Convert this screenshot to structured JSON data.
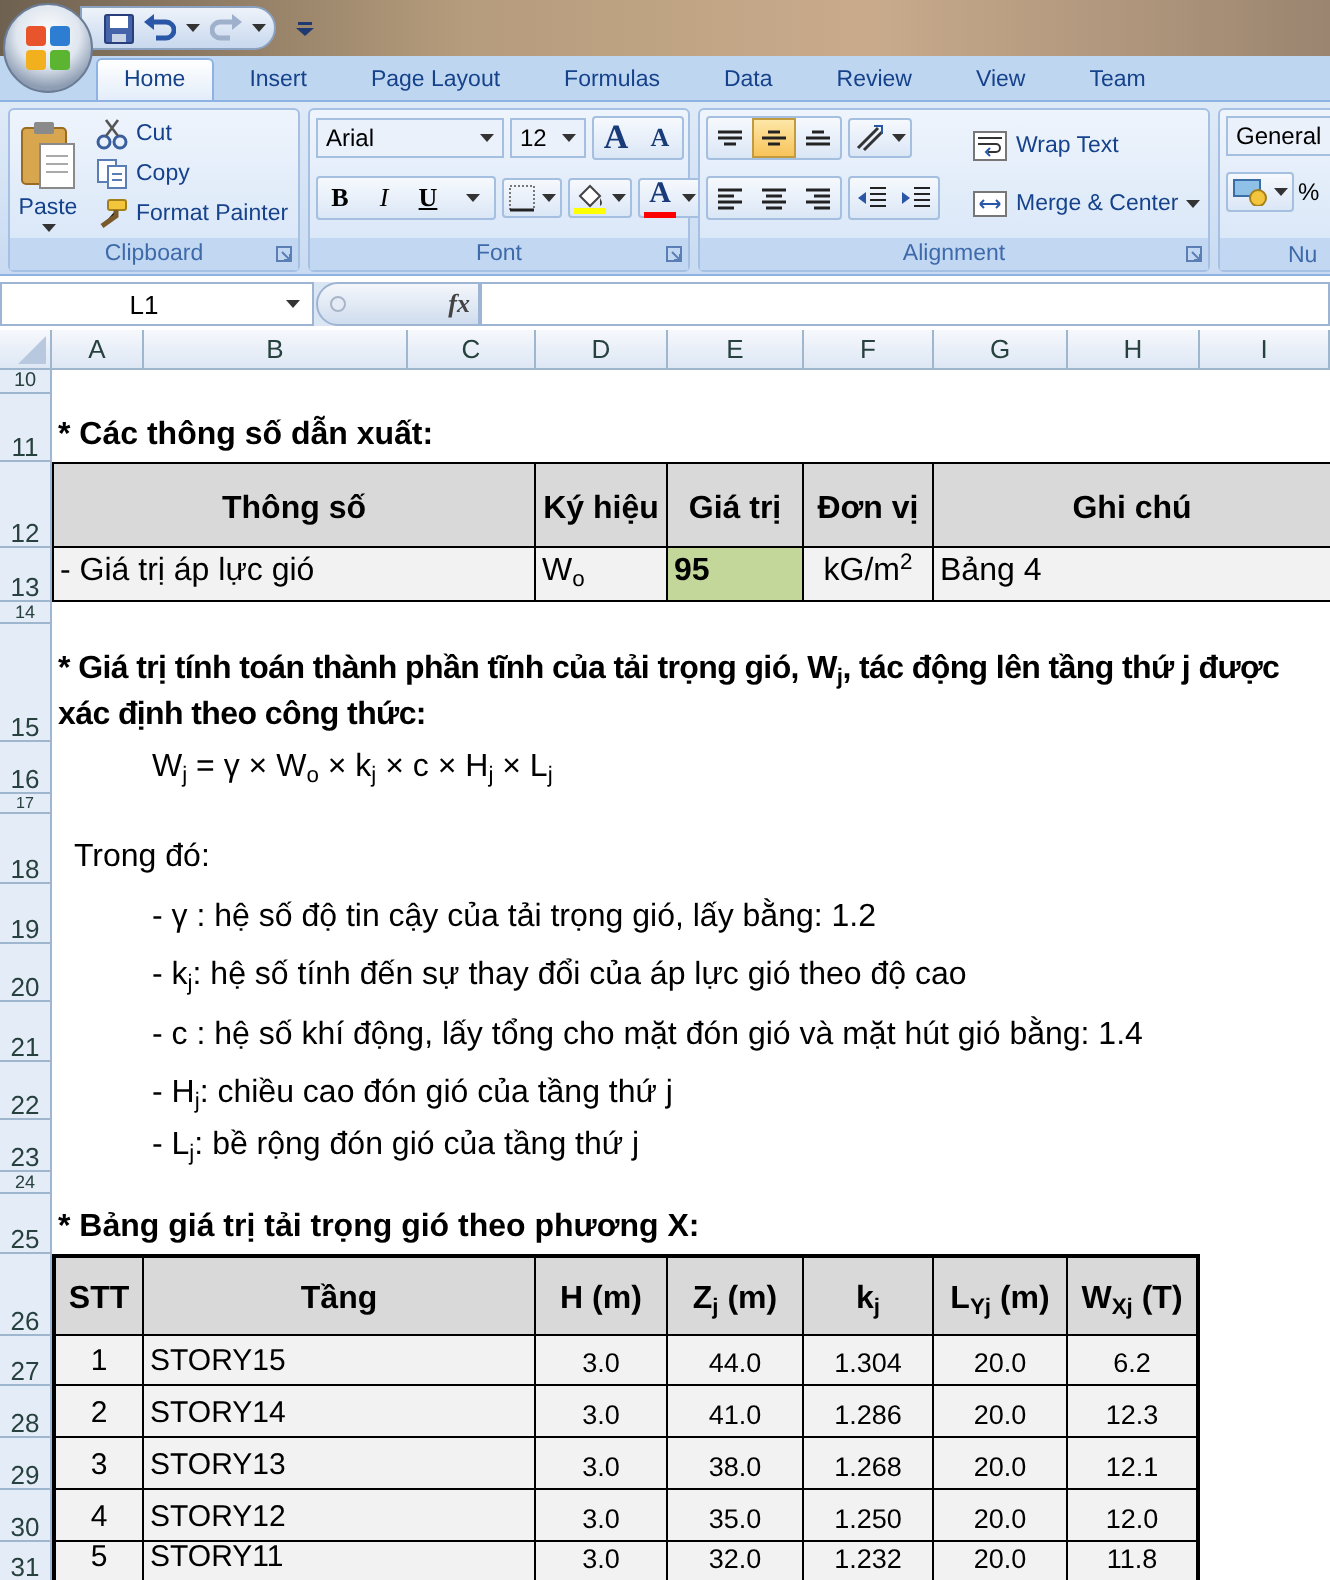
{
  "ribbon": {
    "tabs": [
      {
        "label": "Home",
        "selected": true
      },
      {
        "label": "Insert",
        "selected": false
      },
      {
        "label": "Page Layout",
        "selected": false
      },
      {
        "label": "Formulas",
        "selected": false
      },
      {
        "label": "Data",
        "selected": false
      },
      {
        "label": "Review",
        "selected": false
      },
      {
        "label": "View",
        "selected": false
      },
      {
        "label": "Team",
        "selected": false
      }
    ],
    "clipboard": {
      "paste": "Paste",
      "actions": [
        {
          "kind": "cut",
          "label": "Cut"
        },
        {
          "kind": "copy",
          "label": "Copy"
        },
        {
          "kind": "painter",
          "label": "Format Painter"
        }
      ],
      "label": "Clipboard"
    },
    "font": {
      "name": "Arial",
      "size": "12",
      "size_buttons": [
        {
          "kind": "grow",
          "label": "A"
        },
        {
          "kind": "shrink",
          "label": "A"
        }
      ],
      "style_buttons": [
        {
          "kind": "bold",
          "label": "B"
        },
        {
          "kind": "italic",
          "label": "I"
        },
        {
          "kind": "underline",
          "label": "U"
        }
      ],
      "font_color": "A",
      "label": "Font"
    },
    "alignment": {
      "vertical": [
        {
          "kind": "top",
          "selected": false
        },
        {
          "kind": "middle",
          "selected": true
        },
        {
          "kind": "bottom",
          "selected": false
        }
      ],
      "horizontal": [
        {
          "kind": "left",
          "selected": false
        },
        {
          "kind": "center",
          "selected": false
        },
        {
          "kind": "right",
          "selected": false
        }
      ],
      "wrap_text": "Wrap Text",
      "merge_center": "Merge & Center",
      "label": "Alignment"
    },
    "number": {
      "format": "General",
      "percent": "%",
      "label": "Nu"
    }
  },
  "formula_bar": {
    "name_box": "L1",
    "function_label": "fx"
  },
  "sheet": {
    "column_headers": [
      "A",
      "B",
      "C",
      "D",
      "E",
      "F",
      "G",
      "H",
      "I"
    ],
    "row_numbers": [
      "10",
      "11",
      "12",
      "13",
      "14",
      "15",
      "16",
      "17",
      "18",
      "19",
      "20",
      "21",
      "22",
      "23",
      "24",
      "25",
      "26",
      "27",
      "28",
      "29",
      "30",
      "31"
    ],
    "derived_heading": "* Các thông số dẫn xuất:",
    "params_table": {
      "columns": [
        "Thông số",
        "Ký hiệu",
        "Giá trị",
        "Đơn vị",
        "Ghi chú"
      ],
      "rows": [
        [
          "- Giá trị áp lực gió",
          "W$_{o}$",
          "95",
          "kG/m$^{2}$",
          "Bảng 4"
        ]
      ]
    },
    "formula_heading": "* Giá trị tính toán thành phần tĩnh của tải trọng gió, W$_{j}$, tác động lên tầng thứ j được xác định theo công thức:",
    "formula": "W$_{j}$ = γ × W$_{o}$ × k$_{j}$ × c × H$_{j}$ × L$_{j}$",
    "where_label": "Trong đó:",
    "notes": [
      "- γ : hệ số độ tin cậy của tải trọng gió, lấy bằng: 1.2",
      "- k$_{j}$: hệ số tính đến sự thay đổi của áp lực gió theo độ cao",
      "- c : hệ số khí động, lấy tổng cho mặt đón gió và mặt hút gió bằng: 1.4",
      "- H$_{j}$: chiều cao đón gió của tầng thứ j",
      "- L$_{j}$: bề rộng đón gió của tầng thứ j"
    ],
    "x_table_heading": "* Bảng giá trị tải trọng gió theo phương X:",
    "x_table": {
      "columns": [
        "STT",
        "Tầng",
        "H (m)",
        "Z$_{j}$ (m)",
        "k$_{j}$",
        "L$_{Yj}$ (m)",
        "W$_{Xj}$ (T)"
      ],
      "rows": [
        [
          "1",
          "STORY15",
          "3.0",
          "44.0",
          "1.304",
          "20.0",
          "6.2"
        ],
        [
          "2",
          "STORY14",
          "3.0",
          "41.0",
          "1.286",
          "20.0",
          "12.3"
        ],
        [
          "3",
          "STORY13",
          "3.0",
          "38.0",
          "1.268",
          "20.0",
          "12.1"
        ],
        [
          "4",
          "STORY12",
          "3.0",
          "35.0",
          "1.250",
          "20.0",
          "12.0"
        ],
        [
          "5",
          "STORY11",
          "3.0",
          "32.0",
          "1.232",
          "20.0",
          "11.8"
        ]
      ]
    }
  }
}
